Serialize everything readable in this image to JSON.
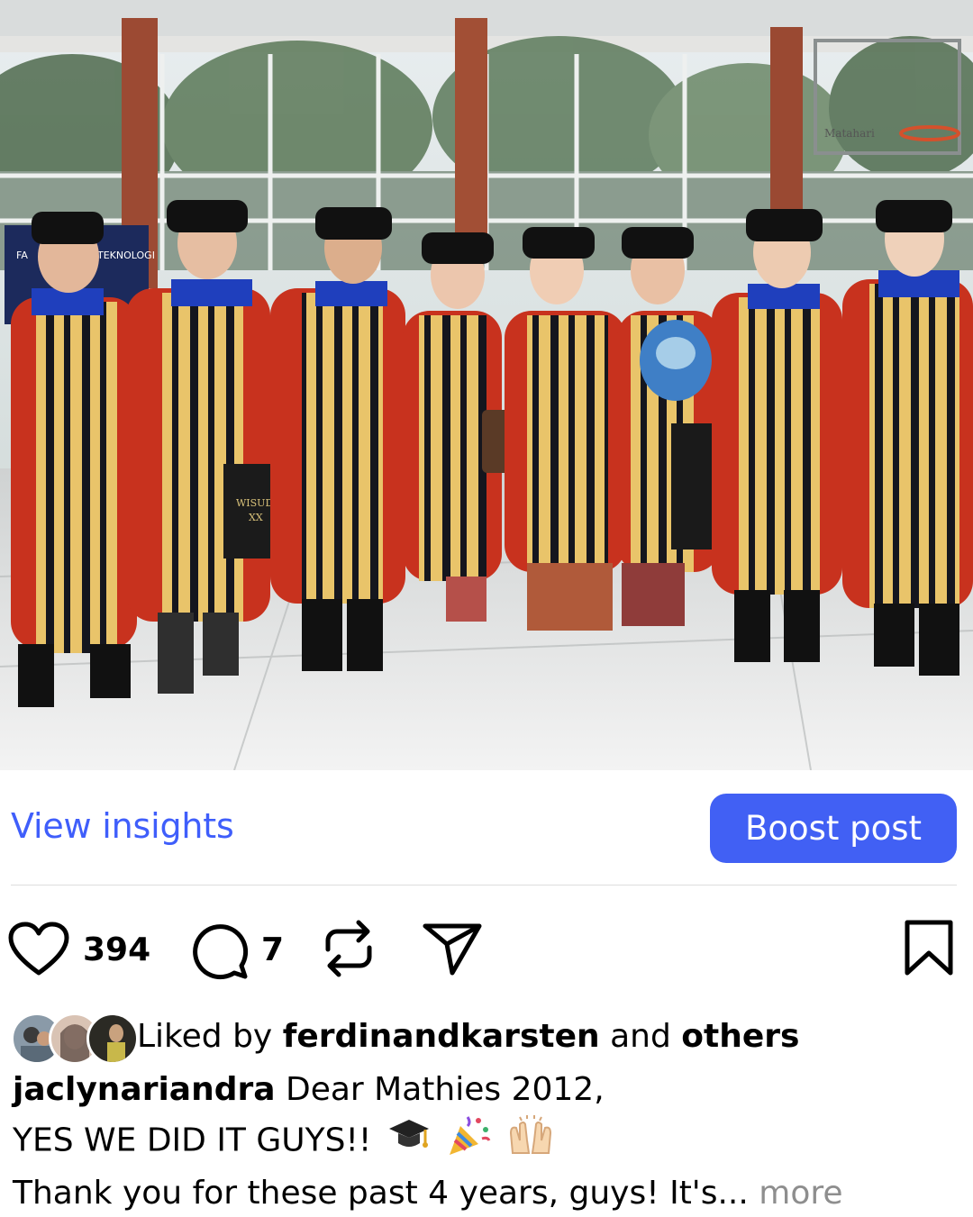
{
  "post": {
    "photo_banner_text": [
      "FA",
      "TEKNOLOGI"
    ],
    "photo_bag_text": [
      "WISUDA",
      "XX"
    ],
    "photo_backboard_text": "Matahari"
  },
  "actions": {
    "view_insights": "View insights",
    "boost_post": "Boost post"
  },
  "engagement": {
    "likes_count": "394",
    "comments_count": "7",
    "icons": [
      "heart-icon",
      "comment-icon",
      "repost-icon",
      "share-icon",
      "bookmark-icon"
    ]
  },
  "likes": {
    "prefix": "Liked by",
    "user": "ferdinandkarsten",
    "and": "and",
    "others": "others"
  },
  "caption": {
    "username": "jaclynariandra",
    "line1": "Dear Mathies 2012,",
    "line2": "YES WE DID IT GUYS!!",
    "line2_emojis": [
      "graduation-cap-emoji",
      "party-popper-emoji",
      "raising-hands-emoji"
    ],
    "line3": "Thank you for these past 4 years, guys! It's...",
    "more": "more"
  },
  "colors": {
    "accent": "#4160F4",
    "link": "#3F5EFB",
    "muted": "#8e8e8e",
    "gown_red": "#C8321E",
    "gown_gold": "#E9C46A"
  }
}
